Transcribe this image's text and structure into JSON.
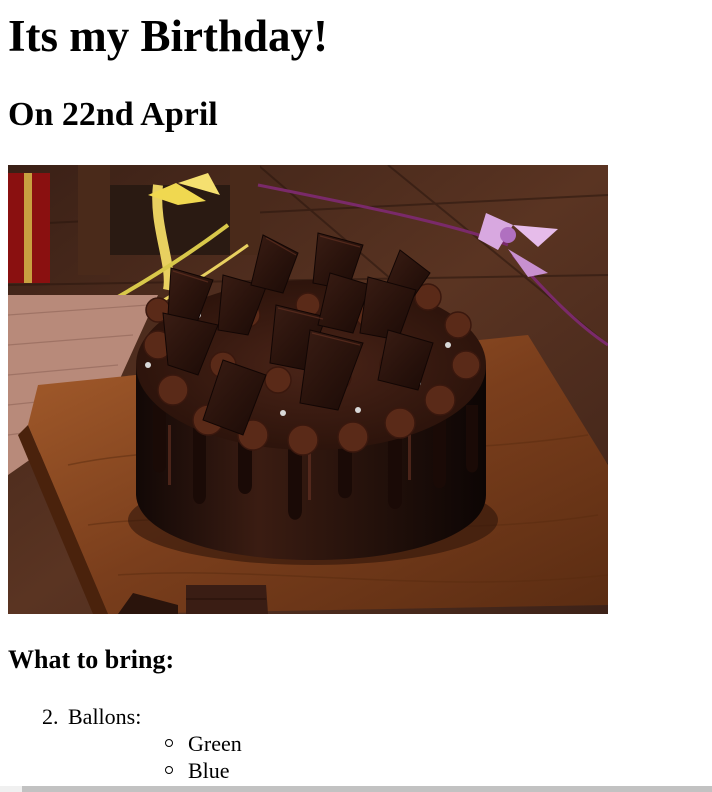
{
  "page": {
    "title": "Its my Birthday!",
    "subtitle": "On 22nd April",
    "image": {
      "subject": "chocolate-cake",
      "colors": {
        "background_wood": "#4a2a1c",
        "board": "#8a4a24",
        "cake": "#2a1510"
      }
    },
    "bring_heading": "What to bring:",
    "bring_list": [
      {
        "number": "2.",
        "label": "Ballons:",
        "sub_items": [
          "Green",
          "Blue"
        ]
      }
    ]
  },
  "scrollbar": {
    "thumb_color": "#c2c2c2",
    "track_color": "#f0f0f0"
  }
}
